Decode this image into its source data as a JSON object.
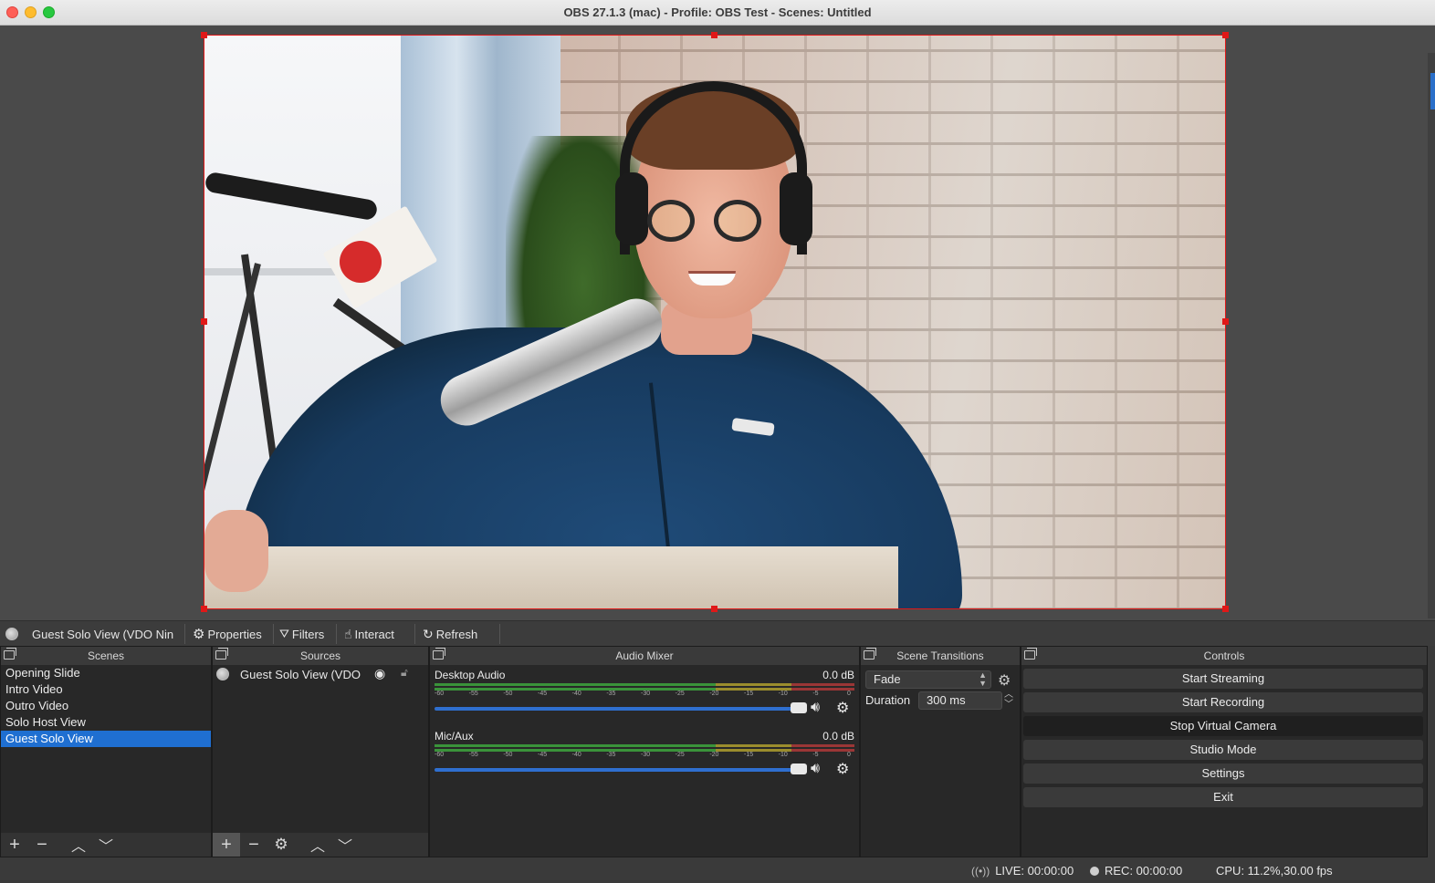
{
  "window": {
    "title": "OBS 27.1.3 (mac) - Profile: OBS Test - Scenes: Untitled"
  },
  "source_toolbar": {
    "selected_source": "Guest Solo View (VDO Nin",
    "properties": "Properties",
    "filters": "Filters",
    "interact": "Interact",
    "refresh": "Refresh"
  },
  "scenes": {
    "title": "Scenes",
    "items": [
      "Opening Slide",
      "Intro Video",
      "Outro Video",
      "Solo Host View",
      "Guest Solo View"
    ],
    "selected_index": 4
  },
  "sources": {
    "title": "Sources",
    "items": [
      {
        "name": "Guest Solo View (VDO",
        "icon": "globe-icon",
        "visible": true,
        "locked": false
      }
    ]
  },
  "mixer": {
    "title": "Audio Mixer",
    "channels": [
      {
        "name": "Desktop Audio",
        "db": "0.0 dB",
        "volume": 1.0
      },
      {
        "name": "Mic/Aux",
        "db": "0.0 dB",
        "volume": 1.0
      }
    ],
    "ticks": [
      "-60",
      "-55",
      "-50",
      "-45",
      "-40",
      "-35",
      "-30",
      "-25",
      "-20",
      "-15",
      "-10",
      "-5",
      "0"
    ]
  },
  "transitions": {
    "title": "Scene Transitions",
    "selected": "Fade",
    "duration_label": "Duration",
    "duration_value": "300 ms"
  },
  "controls": {
    "title": "Controls",
    "buttons": [
      "Start Streaming",
      "Start Recording",
      "Stop Virtual Camera",
      "Studio Mode",
      "Settings",
      "Exit"
    ]
  },
  "status": {
    "live": "LIVE: 00:00:00",
    "rec": "REC: 00:00:00",
    "cpu": "CPU: 11.2%,30.00 fps"
  },
  "colors": {
    "selection": "#1f6fd1",
    "source_outline": "#e01818",
    "meter_green": "#3fae3f",
    "meter_yellow": "#b8a62e",
    "meter_red": "#b83a3a"
  }
}
